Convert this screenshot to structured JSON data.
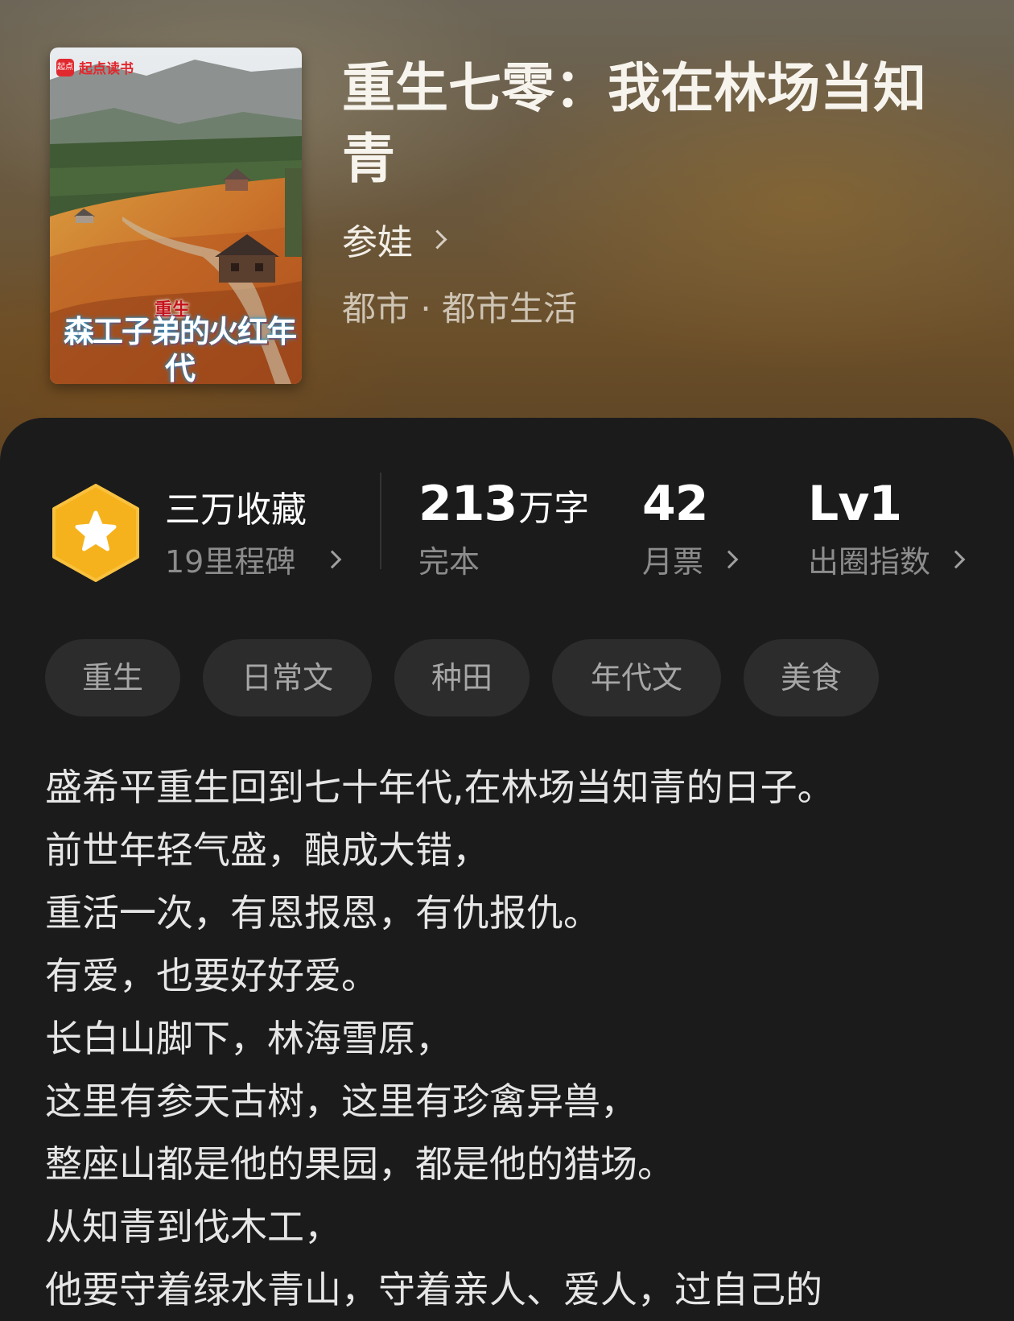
{
  "cover": {
    "brand": "起点读书",
    "brand_logo": "起点",
    "small_title": "重生",
    "big_title": "森工子弟的火红年代",
    "author": "参娃"
  },
  "book": {
    "title": "重生七零：我在林场当知青",
    "author": "参娃",
    "category": "都市 · 都市生活"
  },
  "stats": {
    "milestone_title": "三万收藏",
    "milestone_sub": "19里程碑",
    "words_value": "213",
    "words_unit": "万字",
    "words_label": "完本",
    "monthly_value": "42",
    "monthly_label": "月票",
    "level_value": "Lv1",
    "level_label": "出圈指数"
  },
  "tags": [
    "重生",
    "日常文",
    "种田",
    "年代文",
    "美食"
  ],
  "synopsis": [
    "盛希平重生回到七十年代,在林场当知青的日子。",
    "前世年轻气盛，酿成大错，",
    "重活一次，有恩报恩，有仇报仇。",
    "有爱，也要好好爱。",
    "长白山脚下，林海雪原，",
    "这里有参天古树，这里有珍禽异兽，",
    "整座山都是他的果园，都是他的猎场。",
    "从知青到伐木工，",
    "他要守着绿水青山，守着亲人、爱人，过自己的"
  ],
  "colors": {
    "badge": "#f6b21c",
    "card_bg": "#1b1b1b",
    "tag_bg": "#2c2c2c",
    "brand_red": "#e0292f"
  }
}
